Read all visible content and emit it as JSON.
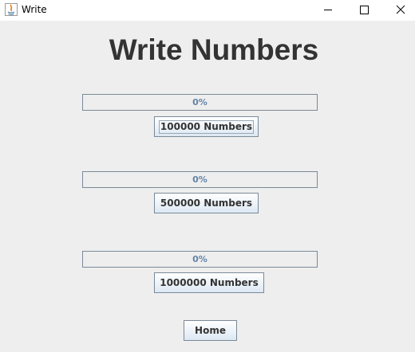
{
  "window": {
    "title": "Write",
    "icon": "java-icon",
    "controls": [
      "minimize-icon",
      "maximize-icon",
      "close-icon"
    ]
  },
  "heading": "Write Numbers",
  "sections": [
    {
      "progress_text": "0%",
      "progress_value": 0,
      "button_label": "100000 Numbers",
      "focused": true
    },
    {
      "progress_text": "0%",
      "progress_value": 0,
      "button_label": "500000 Numbers",
      "focused": false
    },
    {
      "progress_text": "0%",
      "progress_value": 0,
      "button_label": "1000000 Numbers",
      "focused": false
    }
  ],
  "home_button": "Home",
  "colors": {
    "background": "#eeeeee",
    "progress_text": "#6383a8",
    "progress_border": "#7a8a99",
    "button_gradient_bottom": "#dde8f3",
    "heading_text": "#333333"
  }
}
